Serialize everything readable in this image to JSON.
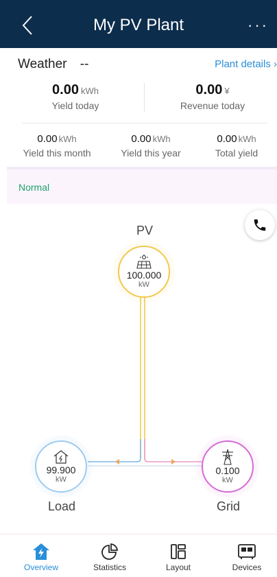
{
  "header": {
    "title": "My PV Plant",
    "more": "···"
  },
  "weather": {
    "label": "Weather",
    "value": "--",
    "details_link": "Plant details"
  },
  "yield_today": {
    "value": "0.00",
    "unit": "kWh",
    "label": "Yield today"
  },
  "revenue_today": {
    "value": "0.00",
    "unit": "¥",
    "label": "Revenue today"
  },
  "yield_month": {
    "value": "0.00",
    "unit": "kWh",
    "label": "Yield this month"
  },
  "yield_year": {
    "value": "0.00",
    "unit": "kWh",
    "label": "Yield this year"
  },
  "yield_total": {
    "value": "0.00",
    "unit": "kWh",
    "label": "Total yield"
  },
  "status": {
    "text": "Normal",
    "color": "#1ea36b"
  },
  "flow": {
    "pv": {
      "label": "PV",
      "value": "100.000",
      "unit": "kW",
      "color": "#f2c94c"
    },
    "load": {
      "label": "Load",
      "value": "99.900",
      "unit": "kW",
      "color": "#7cb8e8"
    },
    "grid": {
      "label": "Grid",
      "value": "0.100",
      "unit": "kW",
      "color": "#d46bd6"
    }
  },
  "tabs": [
    {
      "label": "Overview",
      "active": true
    },
    {
      "label": "Statistics",
      "active": false
    },
    {
      "label": "Layout",
      "active": false
    },
    {
      "label": "Devices",
      "active": false
    }
  ],
  "colors": {
    "header_bg": "#0d2d4c",
    "accent": "#2a8ed8",
    "arrow": "#f2a35b"
  }
}
